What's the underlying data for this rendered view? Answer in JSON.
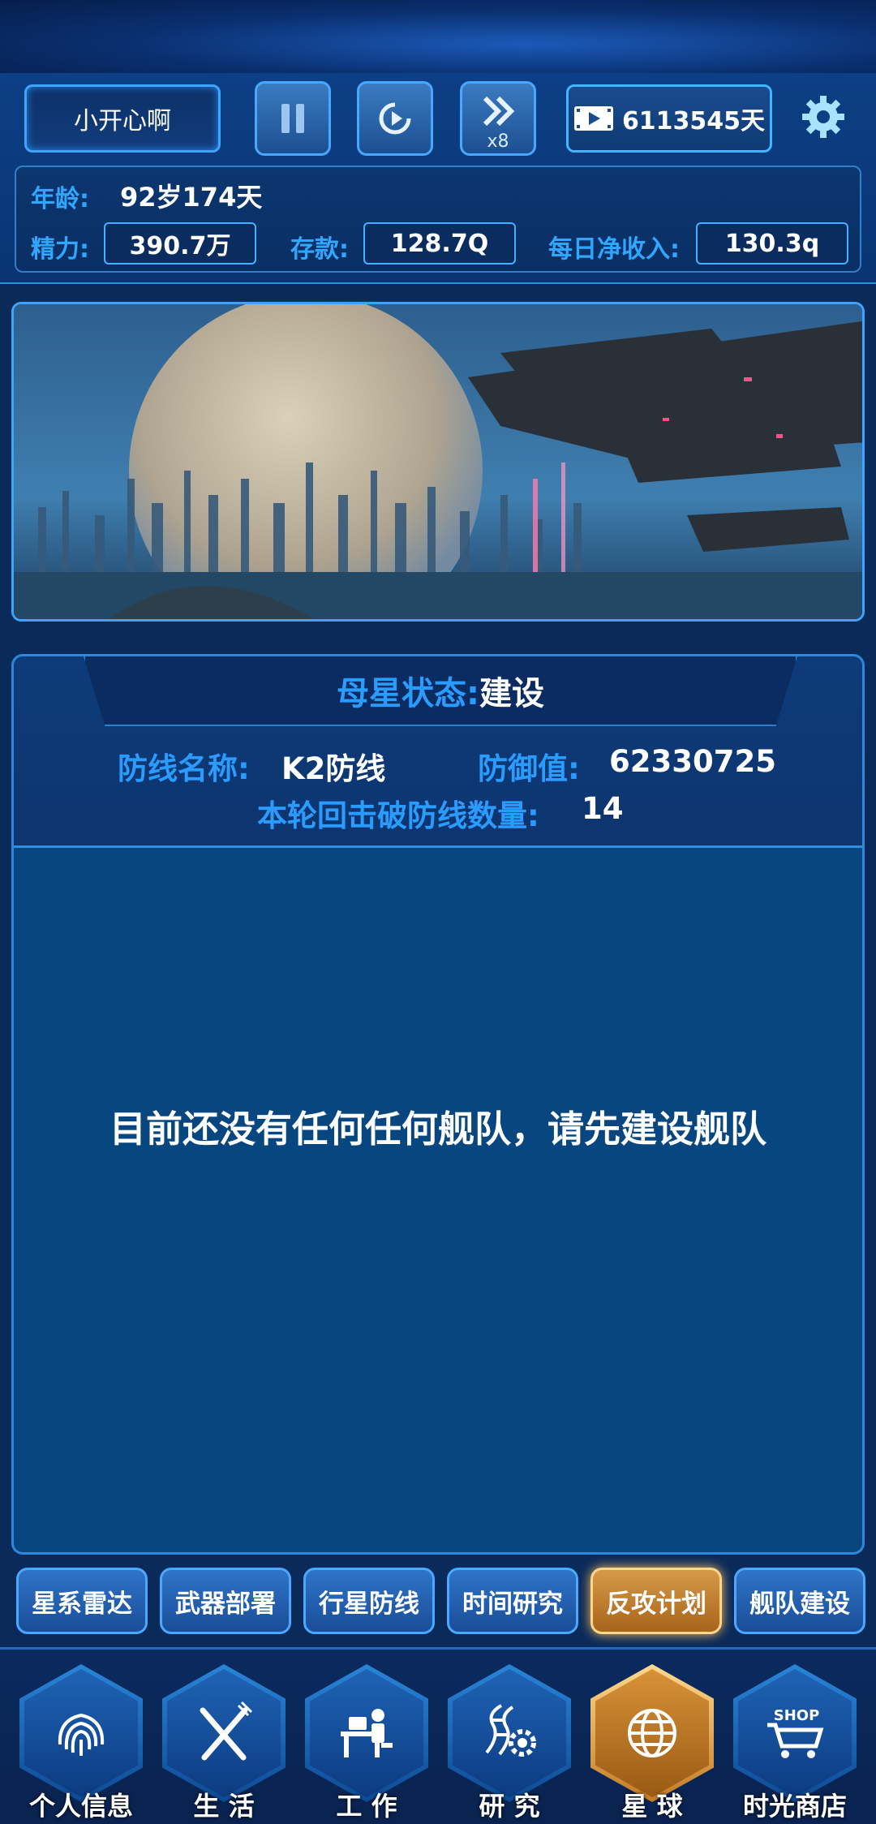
{
  "header": {
    "player_name": "小开心啊",
    "speed_label": "x8",
    "days_value": "6113545天",
    "age_label": "年龄:",
    "age_value": "92岁174天",
    "energy_label": "精力:",
    "energy_value": "390.7万",
    "savings_label": "存款:",
    "savings_value": "128.7Q",
    "income_label": "每日净收入:",
    "income_value": "130.3q"
  },
  "panel": {
    "status_label": "母星状态:",
    "status_value": "建设",
    "defense_name_label": "防线名称:",
    "defense_name_value": "K2防线",
    "defense_value_label": "防御值:",
    "defense_value": "62330725",
    "broken_label": "本轮回击破防线数量:",
    "broken_value": "14",
    "empty_message": "目前还没有任何任何舰队，请先建设舰队"
  },
  "subtabs": [
    "星系雷达",
    "武器部署",
    "行星防线",
    "时间研究",
    "反攻计划",
    "舰队建设"
  ],
  "active_subtab": "反攻计划",
  "nav": [
    "个人信息",
    "生 活",
    "工 作",
    "研 究",
    "星 球",
    "时光商店"
  ],
  "active_nav": "星 球",
  "icons": {
    "pause": "pause-icon",
    "replay": "replay-icon",
    "fast_forward": "fast-forward-icon",
    "video": "video-icon",
    "settings": "gear-icon"
  },
  "colors": {
    "accent": "#2b9cff",
    "active_gold": "#d79a48",
    "panel_bg": "#084680"
  }
}
